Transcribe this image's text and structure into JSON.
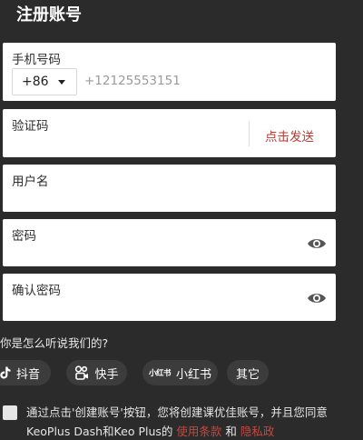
{
  "header": {
    "title": "注册账号"
  },
  "form": {
    "phone": {
      "label": "手机号码",
      "country_code": "+86",
      "placeholder": "+12125553151"
    },
    "code": {
      "label": "验证码",
      "send_label": "点击发送"
    },
    "username": {
      "label": "用户名"
    },
    "password": {
      "label": "密码"
    },
    "confirm_password": {
      "label": "确认密码"
    }
  },
  "source": {
    "question": "你是怎么听说我们的?",
    "options": [
      {
        "label": "抖音",
        "icon": "douyin-icon"
      },
      {
        "label": "快手",
        "icon": "kuaishou-icon"
      },
      {
        "label": "小红书",
        "icon": "xiaohongshu-icon",
        "logo_text": "小红书"
      },
      {
        "label": "其它"
      }
    ]
  },
  "agreement": {
    "text_before": "通过点击'创建账号'按钮，您将创建课优佳账号，并且您同意KeoPlus Dash和Keo Plus的 ",
    "terms_label": "使用条款",
    "connector": " 和 ",
    "privacy_label": "隐私政"
  },
  "colors": {
    "background": "#2b2b2b",
    "accent": "#b83b34",
    "card": "#ffffff",
    "chip": "#3c3c3c"
  }
}
